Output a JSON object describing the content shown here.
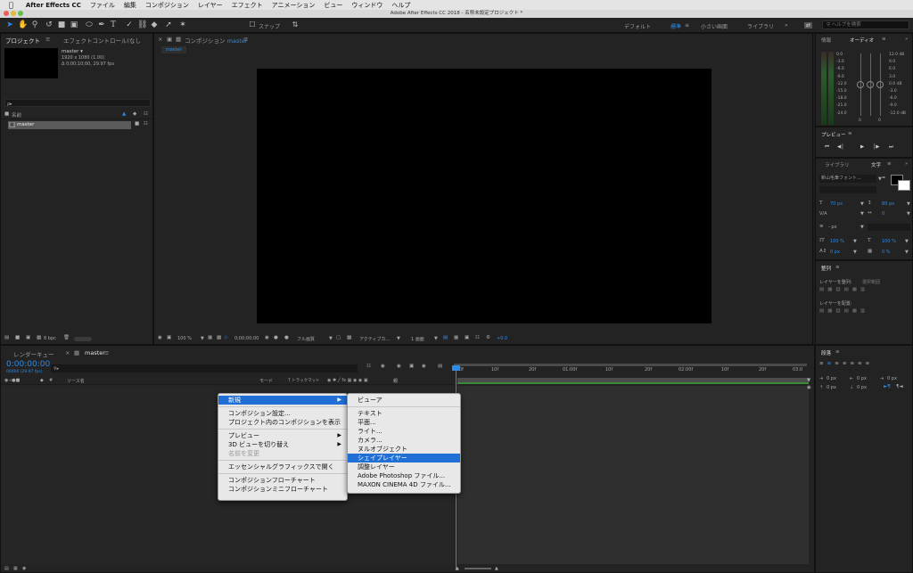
{
  "menubar": {
    "app": "After Effects CC",
    "items": [
      "ファイル",
      "編集",
      "コンポジション",
      "レイヤー",
      "エフェクト",
      "アニメーション",
      "ビュー",
      "ウィンドウ",
      "ヘルプ"
    ]
  },
  "window": {
    "title": "Adobe After Effects CC 2018 - 名称未設定プロジェクト *"
  },
  "toolbar": {
    "snap_label": "スナップ",
    "workspaces": [
      "デフォルト",
      "標準",
      "小さい画面",
      "ライブラリ"
    ],
    "active_workspace": "標準",
    "help_search_placeholder": "ヘルプを検索"
  },
  "project_panel": {
    "tab_project": "プロジェクト",
    "tab_effects": "エフェクトコントロール(なし",
    "selected_item": {
      "name": "master ▾",
      "resolution": "1920 x 1080 (1.00)",
      "duration": "Δ 0;00;10;00, 29.97 fps"
    },
    "search_icon_label": "ρ▸",
    "col_name": "名前",
    "items": [
      {
        "name": "master"
      }
    ],
    "bpc_label": "8 bpc"
  },
  "composition_panel": {
    "tab": "コンポジション",
    "comp_name": "master",
    "flow_label": "master",
    "zoom": "100 %",
    "timecode": "0;00;00;00",
    "quality": "フル画質",
    "camera": "アクティブカ...",
    "views": "1 画面",
    "exposure": "+0.0"
  },
  "right_panels": {
    "info_tab": "情報",
    "audio_tab": "オーディオ",
    "audio_left_scale": [
      "0.0",
      "-3.0",
      "-6.0",
      "-9.0",
      "-12.0",
      "-15.0",
      "-18.0",
      "-21.0",
      "-24.0"
    ],
    "audio_right_scale": [
      "12.0 dB",
      "9.0",
      "6.0",
      "3.0",
      "0.0 dB",
      "-3.0",
      "-6.0",
      "-9.0",
      "-12.0 dB"
    ],
    "audio_zero_left": "0",
    "audio_zero_right": "0",
    "preview_tab": "プレビュー",
    "library_tab": "ライブラリ",
    "character_tab": "文字",
    "font_name": "新山毛筆フォント...",
    "font_size": "70 px",
    "leading": "89 px",
    "kerning_label": "V/A",
    "tracking": "0",
    "stroke_px": "- px",
    "vscale": "100 %",
    "hscale": "100 %",
    "baseline": "0 px",
    "tsume": "0 %",
    "align_tab": "整列",
    "align_layers_label": "レイヤーを整列:",
    "align_target": "選択範囲",
    "distribute_label": "レイヤーを配置:",
    "paragraph_tab": "段落",
    "para_values": [
      "0 px",
      "0 px",
      "0 px",
      "0 px",
      "0 px"
    ]
  },
  "timeline": {
    "tab_render": "レンダーキュー",
    "tab_comp": "master",
    "timecode": "0:00:00:00",
    "fps_note": "00000 (29.97 fps)",
    "col_source": "ソース名",
    "col_mode": "モード",
    "col_trkmat": "T トラックマット",
    "col_parent": "親",
    "ruler": [
      "0f",
      "10f",
      "20f",
      "01:00f",
      "10f",
      "20f",
      "02:00f",
      "10f",
      "20f",
      "03:0"
    ]
  },
  "context_menu": {
    "items": [
      {
        "label": "新規",
        "submenu": true,
        "selected": true
      },
      {
        "sep": true
      },
      {
        "label": "コンポジション設定..."
      },
      {
        "label": "プロジェクト内のコンポジションを表示"
      },
      {
        "sep": true
      },
      {
        "label": "プレビュー",
        "submenu": true
      },
      {
        "label": "3D ビューを切り替え",
        "submenu": true
      },
      {
        "label": "名前を変更",
        "disabled": true
      },
      {
        "sep": true
      },
      {
        "label": "エッセンシャルグラフィックスで開く"
      },
      {
        "sep": true
      },
      {
        "label": "コンポジションフローチャート"
      },
      {
        "label": "コンポジションミニフローチャート"
      }
    ]
  },
  "submenu": {
    "items": [
      {
        "label": "ビューア"
      },
      {
        "sep": true
      },
      {
        "label": "テキスト"
      },
      {
        "label": "平面..."
      },
      {
        "label": "ライト..."
      },
      {
        "label": "カメラ..."
      },
      {
        "label": "ヌルオブジェクト"
      },
      {
        "label": "シェイプレイヤー",
        "selected": true
      },
      {
        "label": "調整レイヤー"
      },
      {
        "label": "Adobe Photoshop ファイル..."
      },
      {
        "label": "MAXON CINEMA 4D ファイル..."
      }
    ]
  },
  "colors": {
    "accent": "#2d8ceb",
    "menu_highlight": "#1f6fd6",
    "audio_green": "#2b5c2b",
    "workarea_green": "#3a8a3a"
  }
}
